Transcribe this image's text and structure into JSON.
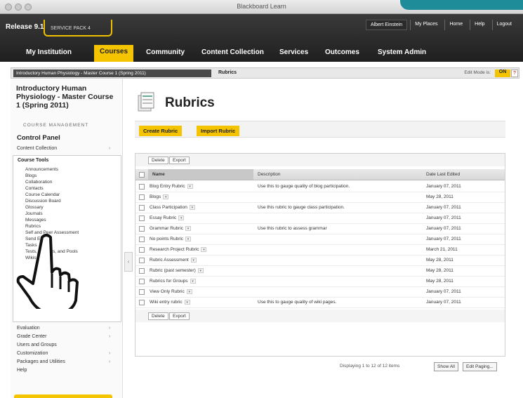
{
  "window": {
    "title": "Blackboard Learn"
  },
  "header": {
    "release": "Release 9.1",
    "service_pack": "SERVICE PACK 4",
    "user_name": "Albert Einstein",
    "util_links": [
      "My Places",
      "Home",
      "Help",
      "Logout"
    ],
    "tabs": [
      "My Institution",
      "Courses",
      "Community",
      "Content Collection",
      "Services",
      "Outcomes",
      "System Admin"
    ],
    "active_tab": "Courses"
  },
  "breadcrumb": {
    "course": "Introductory Human Physiology - Master Course 1 (Spring 2011)",
    "current": "Rubrics",
    "edit_mode_label": "Edit Mode is:",
    "edit_mode_value": "ON"
  },
  "sidebar": {
    "course_title": "Introductory Human Physiology - Master Course 1 (Spring 2011)",
    "course_management": "COURSE MANAGEMENT",
    "control_panel": "Control Panel",
    "content_collection": "Content Collection",
    "course_tools_label": "Course Tools",
    "course_tools": [
      "Announcements",
      "Blogs",
      "Collaboration",
      "Contacts",
      "Course Calendar",
      "Discussion Board",
      "Glossary",
      "Journals",
      "Messages",
      "Rubrics",
      "Self and Peer Assessment",
      "Send Email",
      "Tasks",
      "Tests, Surveys, and Pools",
      "Wikis"
    ],
    "more_items": [
      "Evaluation",
      "Grade Center",
      "Users and Groups",
      "Customization",
      "Packages and Utilities",
      "Help"
    ]
  },
  "main": {
    "title": "Rubrics",
    "create_button": "Create Rubric",
    "import_button": "Import Rubric",
    "delete_label": "Delete",
    "export_label": "Export",
    "columns": [
      "Name",
      "Description",
      "Date Last Edited"
    ],
    "rows": [
      {
        "name": "Blog Entry Rubric",
        "description": "Use this to gauge quality of blog participation.",
        "date": "January 07, 2011"
      },
      {
        "name": "Blogs",
        "description": "",
        "date": "May 28, 2011"
      },
      {
        "name": "Class Participation",
        "description": "Use this rubric to gauge class participation.",
        "date": "January 07, 2011"
      },
      {
        "name": "Essay Rubric",
        "description": "",
        "date": "January 07, 2011"
      },
      {
        "name": "Grammar Rubric",
        "description": "Use this rubric to assess grammar",
        "date": "January 07, 2011"
      },
      {
        "name": "No points Rubric",
        "description": "",
        "date": "January 07, 2011"
      },
      {
        "name": "Research Project Rubric",
        "description": "",
        "date": "March 21, 2011"
      },
      {
        "name": "Rubric Assessment",
        "description": "",
        "date": "May 28, 2011"
      },
      {
        "name": "Rubric (past semester)",
        "description": "",
        "date": "May 28, 2011"
      },
      {
        "name": "Rubrics for Groups",
        "description": "",
        "date": "May 28, 2011"
      },
      {
        "name": "View Only Rubric",
        "description": "",
        "date": "January 07, 2011"
      },
      {
        "name": "Wiki entry rubric",
        "description": "Use this to gauge quality of wiki pages.",
        "date": "January 07, 2011"
      }
    ],
    "displaying": "Displaying 1 to 12 of 12 items",
    "show_all": "Show All",
    "edit_paging": "Edit Paging..."
  }
}
